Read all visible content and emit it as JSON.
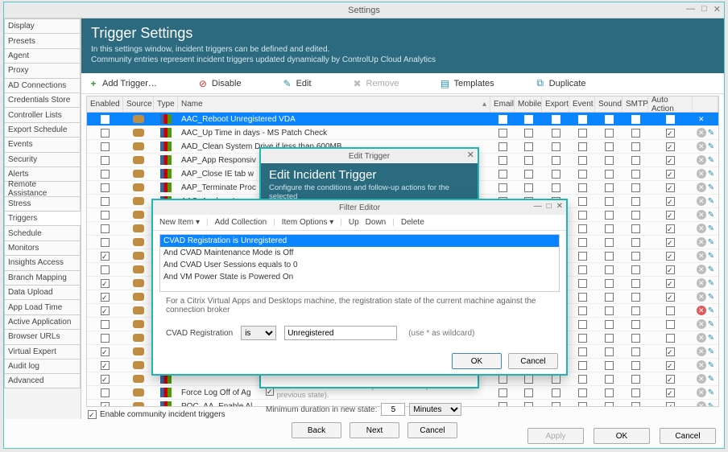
{
  "window": {
    "title": "Settings"
  },
  "sidebar": {
    "items": [
      "Display",
      "Presets",
      "Agent",
      "Proxy",
      "AD Connections",
      "Credentials Store",
      "Controller Lists",
      "Export Schedule",
      "Events",
      "Security",
      "Alerts",
      "Remote Assistance",
      "Stress",
      "Triggers",
      "Schedule",
      "Monitors",
      "Insights Access",
      "Branch Mapping",
      "Data Upload",
      "App Load Time",
      "Active Application",
      "Browser URLs",
      "Virtual Expert",
      "Audit log",
      "Advanced"
    ],
    "active": "Triggers"
  },
  "header": {
    "title": "Trigger Settings",
    "sub1": "In this settings window, incident triggers can be defined and edited.",
    "sub2": "Community entries represent incident triggers updated dynamically by ControlUp Cloud Analytics"
  },
  "toolbar": {
    "add": "Add Trigger…",
    "disable": "Disable",
    "edit": "Edit",
    "remove": "Remove",
    "templates": "Templates",
    "duplicate": "Duplicate"
  },
  "columns": {
    "enabled": "Enabled",
    "source": "Source",
    "type": "Type",
    "name": "Name",
    "email": "Email",
    "mobile": "Mobile",
    "export": "Export",
    "event": "Event",
    "sound": "Sound",
    "smtp": "SMTP",
    "auto": "Auto Action"
  },
  "rows": [
    {
      "enabled": true,
      "name": "AAC_Reboot Unregistered VDA",
      "auto": true,
      "selected": true
    },
    {
      "enabled": false,
      "name": "AAC_Up Time in days - MS Patch Check",
      "auto": true
    },
    {
      "enabled": false,
      "name": "AAD_Clean System Drive if less than 600MB",
      "auto": true
    },
    {
      "enabled": false,
      "name": "AAP_App Responsiv",
      "auto": true
    },
    {
      "enabled": false,
      "name": "AAP_Close IE tab w",
      "auto": true
    },
    {
      "enabled": false,
      "name": "AAP_Terminate Proc",
      "auto": true
    },
    {
      "enabled": false,
      "name": "AAS_Analyze Logon",
      "auto": true
    },
    {
      "enabled": false,
      "name": "",
      "auto": true
    },
    {
      "enabled": false,
      "name": "",
      "auto": true
    },
    {
      "enabled": false,
      "name": "",
      "auto": true
    },
    {
      "enabled": true,
      "name": "",
      "auto": true
    },
    {
      "enabled": false,
      "name": "",
      "auto": true
    },
    {
      "enabled": true,
      "name": "",
      "auto": true
    },
    {
      "enabled": true,
      "name": "",
      "auto": true
    },
    {
      "enabled": true,
      "name": "",
      "auto": false,
      "del": true
    },
    {
      "enabled": false,
      "name": "",
      "auto": false
    },
    {
      "enabled": false,
      "name": "",
      "auto": false
    },
    {
      "enabled": true,
      "name": "",
      "auto": true
    },
    {
      "enabled": true,
      "name": "",
      "auto": true
    },
    {
      "enabled": true,
      "name": "",
      "auto": true
    },
    {
      "enabled": false,
      "name": "Force Log Off of Ag",
      "auto": true
    },
    {
      "enabled": true,
      "name": "POC_AA_Enable Al",
      "auto": true
    }
  ],
  "community": {
    "label": "Enable community incident triggers",
    "checked": true
  },
  "buttons": {
    "apply": "Apply",
    "ok": "OK",
    "cancel": "Cancel"
  },
  "edit_dialog": {
    "title": "Edit Trigger",
    "heading": "Edit Incident Trigger",
    "sub": "Configure the conditions and follow-up actions for the selected",
    "discovered": "Include machines that were just discovered (i.e. have no previous state).",
    "min_dur_label": "Minimum duration in new state:",
    "min_dur_value": "5",
    "min_dur_units": "Minutes",
    "back": "Back",
    "next": "Next",
    "cancel": "Cancel"
  },
  "filter_editor": {
    "title": "Filter Editor",
    "menu": {
      "new_item": "New Item",
      "add_collection": "Add Collection",
      "item_options": "Item Options",
      "up": "Up",
      "down": "Down",
      "delete": "Delete"
    },
    "conditions": [
      "CVAD Registration is Unregistered",
      "And CVAD Maintenance Mode is Off",
      "And CVAD User Sessions equals to 0",
      "And VM Power State is Powered On"
    ],
    "selected_condition_index": 0,
    "help": "For a Citrix Virtual Apps and Desktops machine, the registration state of the current machine against the connection broker",
    "field_label": "CVAD Registration",
    "op": "is",
    "value": "Unregistered",
    "hint": "(use * as wildcard)",
    "ok": "OK",
    "cancel": "Cancel"
  }
}
